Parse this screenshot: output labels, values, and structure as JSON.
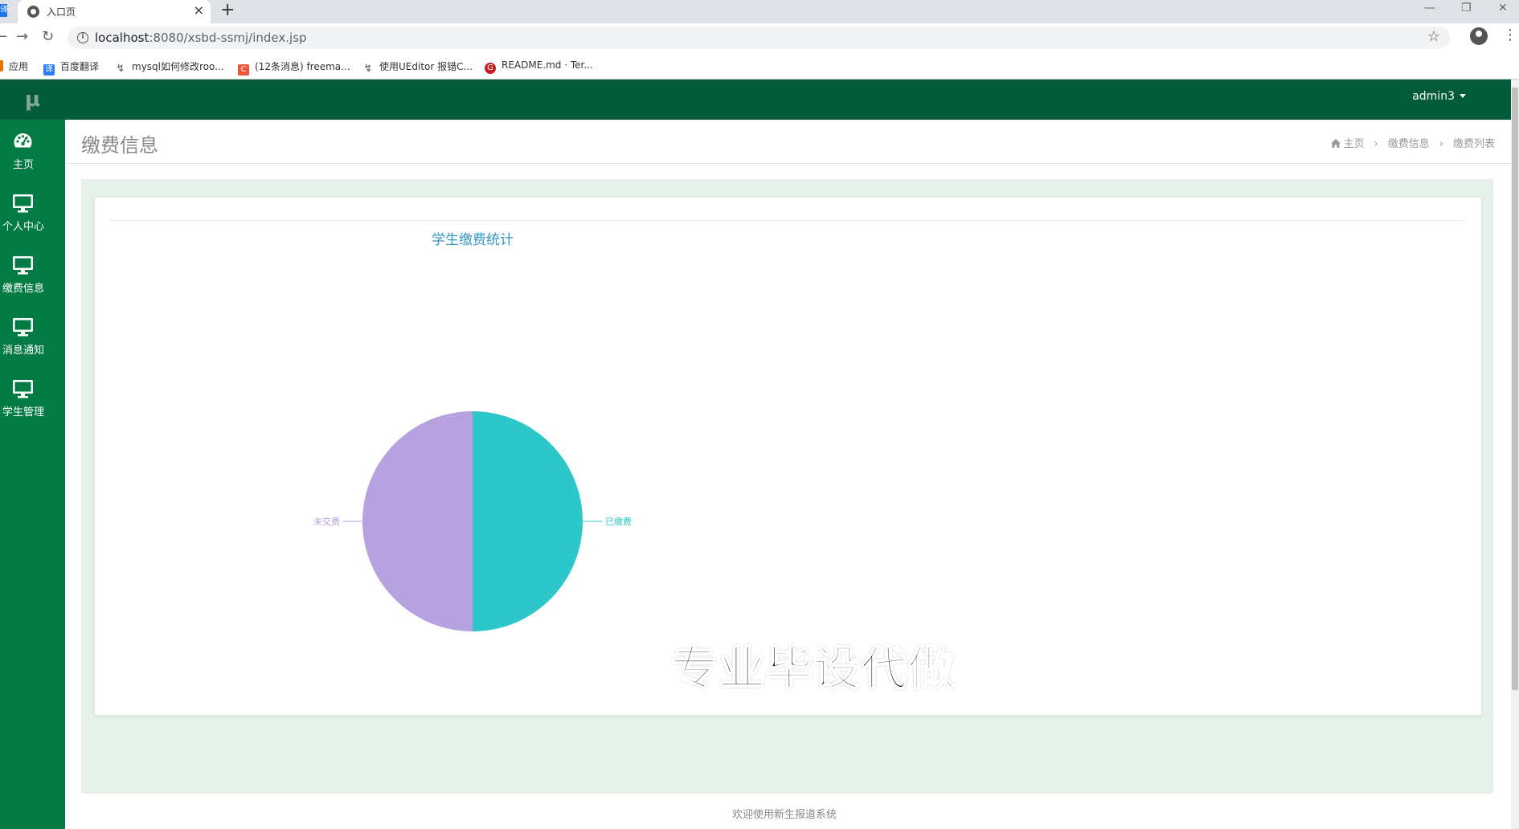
{
  "browser": {
    "tab_title": "入口页",
    "tab_close": "×",
    "new_tab": "+",
    "url_host": "localhost",
    "url_path": ":8080/xsbd-ssmj/index.jsp",
    "bookmarks": [
      {
        "label": "应用",
        "icon": "apps-icon",
        "color": "#e8710a"
      },
      {
        "label": "百度翻译",
        "icon": "translate-icon",
        "color": "#2a7ef5"
      },
      {
        "label": "mysql如何修改roo...",
        "icon": "cache-icon",
        "color": "#555555"
      },
      {
        "label": "(12条消息) freema...",
        "icon": "csdn-icon",
        "color": "#e8593c"
      },
      {
        "label": "使用UEditor 报错C...",
        "icon": "cache-icon",
        "color": "#555555"
      },
      {
        "label": "README.md · Ter...",
        "icon": "gitee-icon",
        "color": "#c71d23"
      }
    ]
  },
  "app": {
    "brand": "μ",
    "user": "admin3",
    "sidebar": [
      {
        "label": "主页",
        "icon": "dashboard-icon"
      },
      {
        "label": "个人中心",
        "icon": "desktop-icon"
      },
      {
        "label": "缴费信息",
        "icon": "desktop-icon"
      },
      {
        "label": "消息通知",
        "icon": "desktop-icon"
      },
      {
        "label": "学生管理",
        "icon": "desktop-icon"
      }
    ],
    "page_title": "缴费信息",
    "breadcrumb": {
      "home": "主页",
      "level1": "缴费信息",
      "level2": "缴费列表"
    },
    "watermark": "专业毕设代做",
    "footer": "欢迎使用新生报道系统"
  },
  "chart_data": {
    "type": "pie",
    "title": "学生缴费统计",
    "labels": [
      "已缴费",
      "未交费"
    ],
    "values": [
      50,
      50
    ],
    "colors": [
      "#2ec7c9",
      "#b6a2de"
    ]
  }
}
